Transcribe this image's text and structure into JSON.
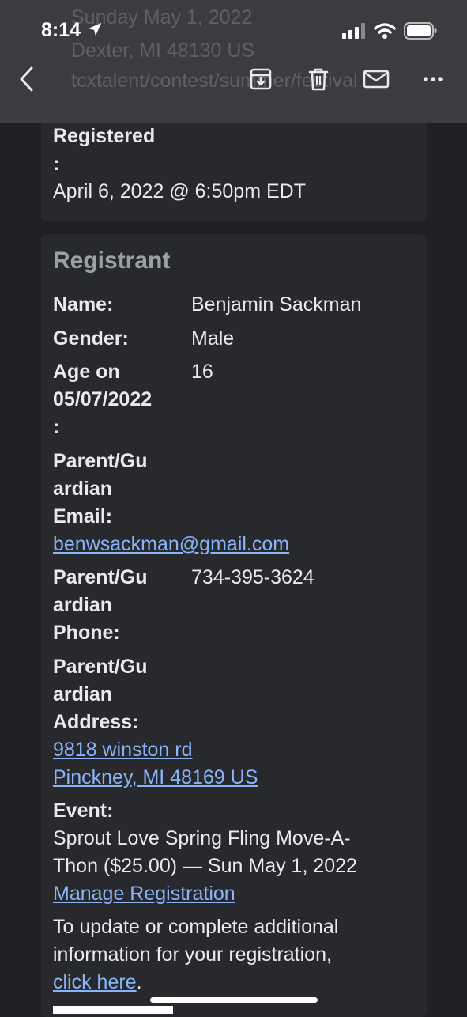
{
  "status_bar": {
    "time": "8:14"
  },
  "ghost_text": {
    "line1": "Sunday May 1, 2022",
    "line2": "Dexter, MI 48130 US",
    "line3": "tcxtalent/contest/summer/festival"
  },
  "toolbar": {
    "back_icon": "chevron-left-icon",
    "archive_icon": "archive-icon",
    "delete_icon": "trash-icon",
    "mark_unread_icon": "mail-icon",
    "more_icon": "more-horizontal-icon"
  },
  "registered": {
    "label": "Registered",
    "colon": ":",
    "value": "April 6, 2022 @ 6:50pm EDT"
  },
  "registrant": {
    "heading": "Registrant",
    "name_label": "Name:",
    "name_value": "Benjamin Sackman",
    "gender_label": "Gender:",
    "gender_value": "Male",
    "age_label_1": "Age on",
    "age_label_2": "05/07/2022",
    "age_label_3": ":",
    "age_value": "16",
    "email_label_1": "Parent/Gu",
    "email_label_2": "ardian",
    "email_label_3": "Email:",
    "email_value": "benwsackman@gmail.com",
    "phone_label_1": "Parent/Gu",
    "phone_label_2": "ardian",
    "phone_label_3": "Phone:",
    "phone_value": "734-395-3624",
    "address_label_1": "Parent/Gu",
    "address_label_2": "ardian",
    "address_label_3": "Address:",
    "address_line1": "9818 winston rd ",
    "address_line2": "Pinckney, MI 48169 US",
    "event_label": "Event:",
    "event_line1": "Sprout Love Spring Fling Move-A-",
    "event_line2": "Thon ($25.00) — Sun May 1, 2022",
    "manage_link": "Manage Registration",
    "update_line1": "To update or complete additional",
    "update_line2": "information for your registration,",
    "click_here": "click here",
    "period": "."
  }
}
